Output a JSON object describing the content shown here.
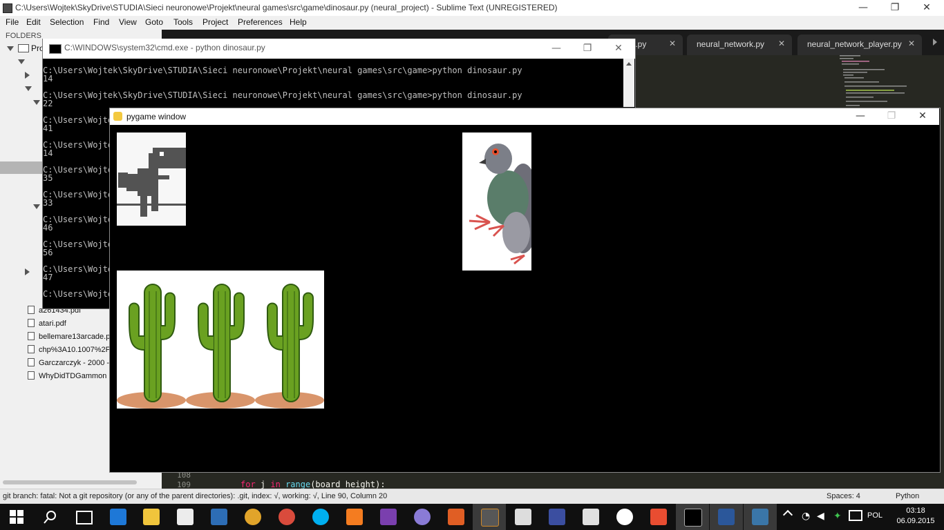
{
  "sublime": {
    "title": "C:\\Users\\Wojtek\\SkyDrive\\STUDIA\\Sieci neuronowe\\Projekt\\neural games\\src\\game\\dinosaur.py (neural_project) - Sublime Text (UNREGISTERED)",
    "menu": [
      "File",
      "Edit",
      "Selection",
      "Find",
      "View",
      "Goto",
      "Tools",
      "Project",
      "Preferences",
      "Help"
    ],
    "tabs": [
      {
        "label": "r.py"
      },
      {
        "label": "neural_network.py"
      },
      {
        "label": "neural_network_player.py"
      }
    ],
    "sidebar": {
      "header": "FOLDERS",
      "project": "Pro",
      "files": [
        "a261434.pdf",
        "atari.pdf",
        "bellemare13arcade.p",
        "chp%3A10.1007%2F",
        "Garczarczyk - 2000 -",
        "WhyDidTDGammon"
      ]
    },
    "gutter": [
      "108",
      "109"
    ],
    "code": "for j in range(board_height):",
    "status_left": "git branch: fatal: Not a git repository (or any of the parent directories): .git, index: √, working: √, Line 90, Column 20",
    "status_spaces": "Spaces: 4",
    "status_syntax": "Python",
    "window_buttons": {
      "minimize": "—",
      "maximize": "❐",
      "close": "✕"
    }
  },
  "cmd": {
    "title": "C:\\WINDOWS\\system32\\cmd.exe - python  dinosaur.py",
    "full_prompt": "C:\\Users\\Wojtek\\SkyDrive\\STUDIA\\Sieci neuronowe\\Projekt\\neural games\\src\\game>python dinosaur.py",
    "short_prompt": "C:\\Users\\Wojte",
    "numbers": [
      "14",
      "22",
      "41",
      "14",
      "35",
      "33",
      "46",
      "56",
      "47"
    ]
  },
  "pygame": {
    "title": "pygame window"
  },
  "taskbar": {
    "language": "POL",
    "time": "03:18",
    "date": "06.09.2015"
  },
  "colors": {
    "editor_bg": "#272822",
    "taskbar_bg": "#101010",
    "cactus_green": "#6aa121"
  }
}
